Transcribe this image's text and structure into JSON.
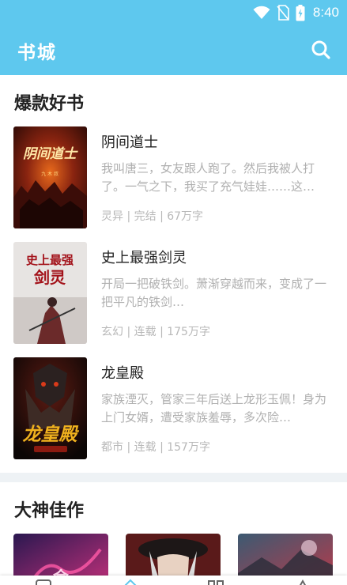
{
  "status_bar": {
    "time": "8:40",
    "icons": [
      "wifi-icon",
      "no-sim-icon",
      "battery-charging-icon"
    ]
  },
  "header": {
    "title": "书城",
    "search_icon": "search-icon"
  },
  "sections": [
    {
      "title": "爆款好书",
      "books": [
        {
          "title": "阴间道士",
          "description": "我叫唐三，女友跟人跑了。然后我被人打了。一气之下，我买了充气娃娃……这…",
          "meta": "灵异 | 完结 | 67万字",
          "cover_text": "阴间道士"
        },
        {
          "title": "史上最强剑灵",
          "description": "开局一把破铁剑。萧渐穿越而来，变成了一把平凡的铁剑…",
          "meta": "玄幻 | 连载 | 175万字",
          "cover_text": "史上最强剑灵"
        },
        {
          "title": "龙皇殿",
          "description": "家族湮灭，管家三年后送上龙形玉佩！身为上门女婿，遭受家族羞辱，多次险…",
          "meta": "都市 | 连载 | 157万字",
          "cover_text": "龙皇殿"
        }
      ]
    },
    {
      "title": "大神佳作"
    }
  ],
  "colors": {
    "primary": "#5ec8ee",
    "text_primary": "#222222",
    "text_secondary": "#b0b0b0",
    "divider": "#eef2f5"
  }
}
